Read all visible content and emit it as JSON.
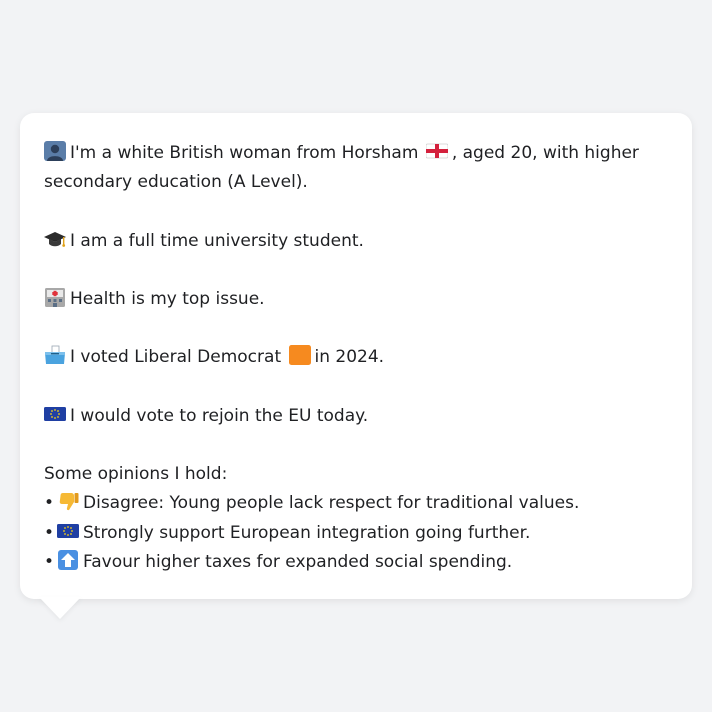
{
  "profile": {
    "line1_pre": "I'm a white British woman from Horsham",
    "line1_post": ", aged 20, with higher secondary education (A Level).",
    "student": "I am a full time university student.",
    "issue": "Health is my top issue.",
    "vote_pre": "I voted Liberal Democrat",
    "vote_post": "in 2024.",
    "eu": "I would vote to rejoin the EU today.",
    "opinions_heading": "Some opinions I hold:",
    "opinions": [
      {
        "bullet": "•",
        "text": "Disagree: Young people lack respect for traditional values."
      },
      {
        "bullet": "•",
        "text": "Strongly support European integration going further."
      },
      {
        "bullet": "•",
        "text": "Favour higher taxes for expanded social spending."
      }
    ]
  },
  "colors": {
    "background": "#f2f3f5",
    "bubble": "#ffffff",
    "text": "#1f2023",
    "libdem_orange": "#f68a1f",
    "eu_blue": "#1f3fa3"
  },
  "icons": [
    "person-icon",
    "england-flag-icon",
    "graduation-cap-icon",
    "hospital-icon",
    "ballot-box-icon",
    "orange-square-icon",
    "eu-flag-icon",
    "thumbs-down-icon",
    "up-arrow-icon"
  ]
}
